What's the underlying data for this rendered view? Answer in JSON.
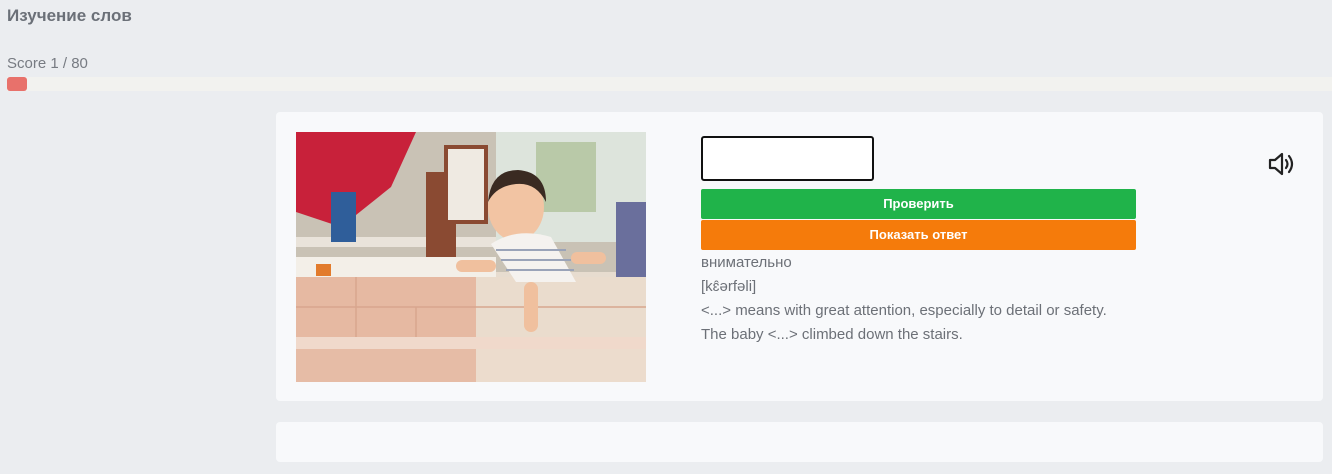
{
  "page": {
    "title": "Изучение слов"
  },
  "score": {
    "label": "Score 1 / 80",
    "current": 1,
    "total": 80,
    "fraction": 0.0125
  },
  "exercise": {
    "answer_value": "",
    "check_label": "Проверить",
    "show_answer_label": "Показать ответ",
    "translation": "внимательно",
    "transcription": "[kɛ̂ərfəli]",
    "definition": "<...> means with great attention, especially to detail or safety.",
    "example": "The baby <...> climbed down the stairs.",
    "speaker_icon": "speaker-icon",
    "image_alt": "baby climbing down stairs"
  },
  "colors": {
    "progress": "#e8716b",
    "check_button": "#20b34a",
    "show_answer_button": "#f57b0b"
  }
}
